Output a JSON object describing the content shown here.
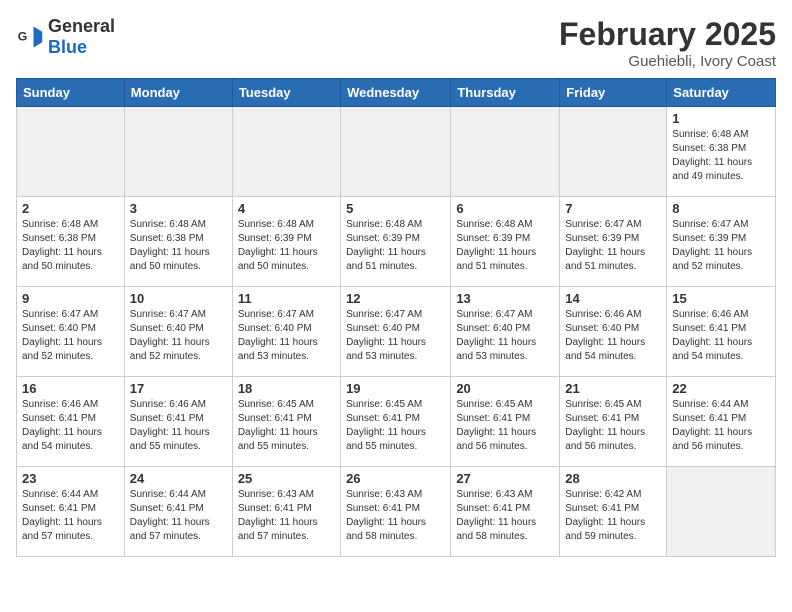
{
  "logo": {
    "general": "General",
    "blue": "Blue"
  },
  "title": "February 2025",
  "location": "Guehiebli, Ivory Coast",
  "days_of_week": [
    "Sunday",
    "Monday",
    "Tuesday",
    "Wednesday",
    "Thursday",
    "Friday",
    "Saturday"
  ],
  "weeks": [
    [
      {
        "day": "",
        "info": ""
      },
      {
        "day": "",
        "info": ""
      },
      {
        "day": "",
        "info": ""
      },
      {
        "day": "",
        "info": ""
      },
      {
        "day": "",
        "info": ""
      },
      {
        "day": "",
        "info": ""
      },
      {
        "day": "1",
        "info": "Sunrise: 6:48 AM\nSunset: 6:38 PM\nDaylight: 11 hours and 49 minutes."
      }
    ],
    [
      {
        "day": "2",
        "info": "Sunrise: 6:48 AM\nSunset: 6:38 PM\nDaylight: 11 hours and 50 minutes."
      },
      {
        "day": "3",
        "info": "Sunrise: 6:48 AM\nSunset: 6:38 PM\nDaylight: 11 hours and 50 minutes."
      },
      {
        "day": "4",
        "info": "Sunrise: 6:48 AM\nSunset: 6:39 PM\nDaylight: 11 hours and 50 minutes."
      },
      {
        "day": "5",
        "info": "Sunrise: 6:48 AM\nSunset: 6:39 PM\nDaylight: 11 hours and 51 minutes."
      },
      {
        "day": "6",
        "info": "Sunrise: 6:48 AM\nSunset: 6:39 PM\nDaylight: 11 hours and 51 minutes."
      },
      {
        "day": "7",
        "info": "Sunrise: 6:47 AM\nSunset: 6:39 PM\nDaylight: 11 hours and 51 minutes."
      },
      {
        "day": "8",
        "info": "Sunrise: 6:47 AM\nSunset: 6:39 PM\nDaylight: 11 hours and 52 minutes."
      }
    ],
    [
      {
        "day": "9",
        "info": "Sunrise: 6:47 AM\nSunset: 6:40 PM\nDaylight: 11 hours and 52 minutes."
      },
      {
        "day": "10",
        "info": "Sunrise: 6:47 AM\nSunset: 6:40 PM\nDaylight: 11 hours and 52 minutes."
      },
      {
        "day": "11",
        "info": "Sunrise: 6:47 AM\nSunset: 6:40 PM\nDaylight: 11 hours and 53 minutes."
      },
      {
        "day": "12",
        "info": "Sunrise: 6:47 AM\nSunset: 6:40 PM\nDaylight: 11 hours and 53 minutes."
      },
      {
        "day": "13",
        "info": "Sunrise: 6:47 AM\nSunset: 6:40 PM\nDaylight: 11 hours and 53 minutes."
      },
      {
        "day": "14",
        "info": "Sunrise: 6:46 AM\nSunset: 6:40 PM\nDaylight: 11 hours and 54 minutes."
      },
      {
        "day": "15",
        "info": "Sunrise: 6:46 AM\nSunset: 6:41 PM\nDaylight: 11 hours and 54 minutes."
      }
    ],
    [
      {
        "day": "16",
        "info": "Sunrise: 6:46 AM\nSunset: 6:41 PM\nDaylight: 11 hours and 54 minutes."
      },
      {
        "day": "17",
        "info": "Sunrise: 6:46 AM\nSunset: 6:41 PM\nDaylight: 11 hours and 55 minutes."
      },
      {
        "day": "18",
        "info": "Sunrise: 6:45 AM\nSunset: 6:41 PM\nDaylight: 11 hours and 55 minutes."
      },
      {
        "day": "19",
        "info": "Sunrise: 6:45 AM\nSunset: 6:41 PM\nDaylight: 11 hours and 55 minutes."
      },
      {
        "day": "20",
        "info": "Sunrise: 6:45 AM\nSunset: 6:41 PM\nDaylight: 11 hours and 56 minutes."
      },
      {
        "day": "21",
        "info": "Sunrise: 6:45 AM\nSunset: 6:41 PM\nDaylight: 11 hours and 56 minutes."
      },
      {
        "day": "22",
        "info": "Sunrise: 6:44 AM\nSunset: 6:41 PM\nDaylight: 11 hours and 56 minutes."
      }
    ],
    [
      {
        "day": "23",
        "info": "Sunrise: 6:44 AM\nSunset: 6:41 PM\nDaylight: 11 hours and 57 minutes."
      },
      {
        "day": "24",
        "info": "Sunrise: 6:44 AM\nSunset: 6:41 PM\nDaylight: 11 hours and 57 minutes."
      },
      {
        "day": "25",
        "info": "Sunrise: 6:43 AM\nSunset: 6:41 PM\nDaylight: 11 hours and 57 minutes."
      },
      {
        "day": "26",
        "info": "Sunrise: 6:43 AM\nSunset: 6:41 PM\nDaylight: 11 hours and 58 minutes."
      },
      {
        "day": "27",
        "info": "Sunrise: 6:43 AM\nSunset: 6:41 PM\nDaylight: 11 hours and 58 minutes."
      },
      {
        "day": "28",
        "info": "Sunrise: 6:42 AM\nSunset: 6:41 PM\nDaylight: 11 hours and 59 minutes."
      },
      {
        "day": "",
        "info": ""
      }
    ]
  ]
}
